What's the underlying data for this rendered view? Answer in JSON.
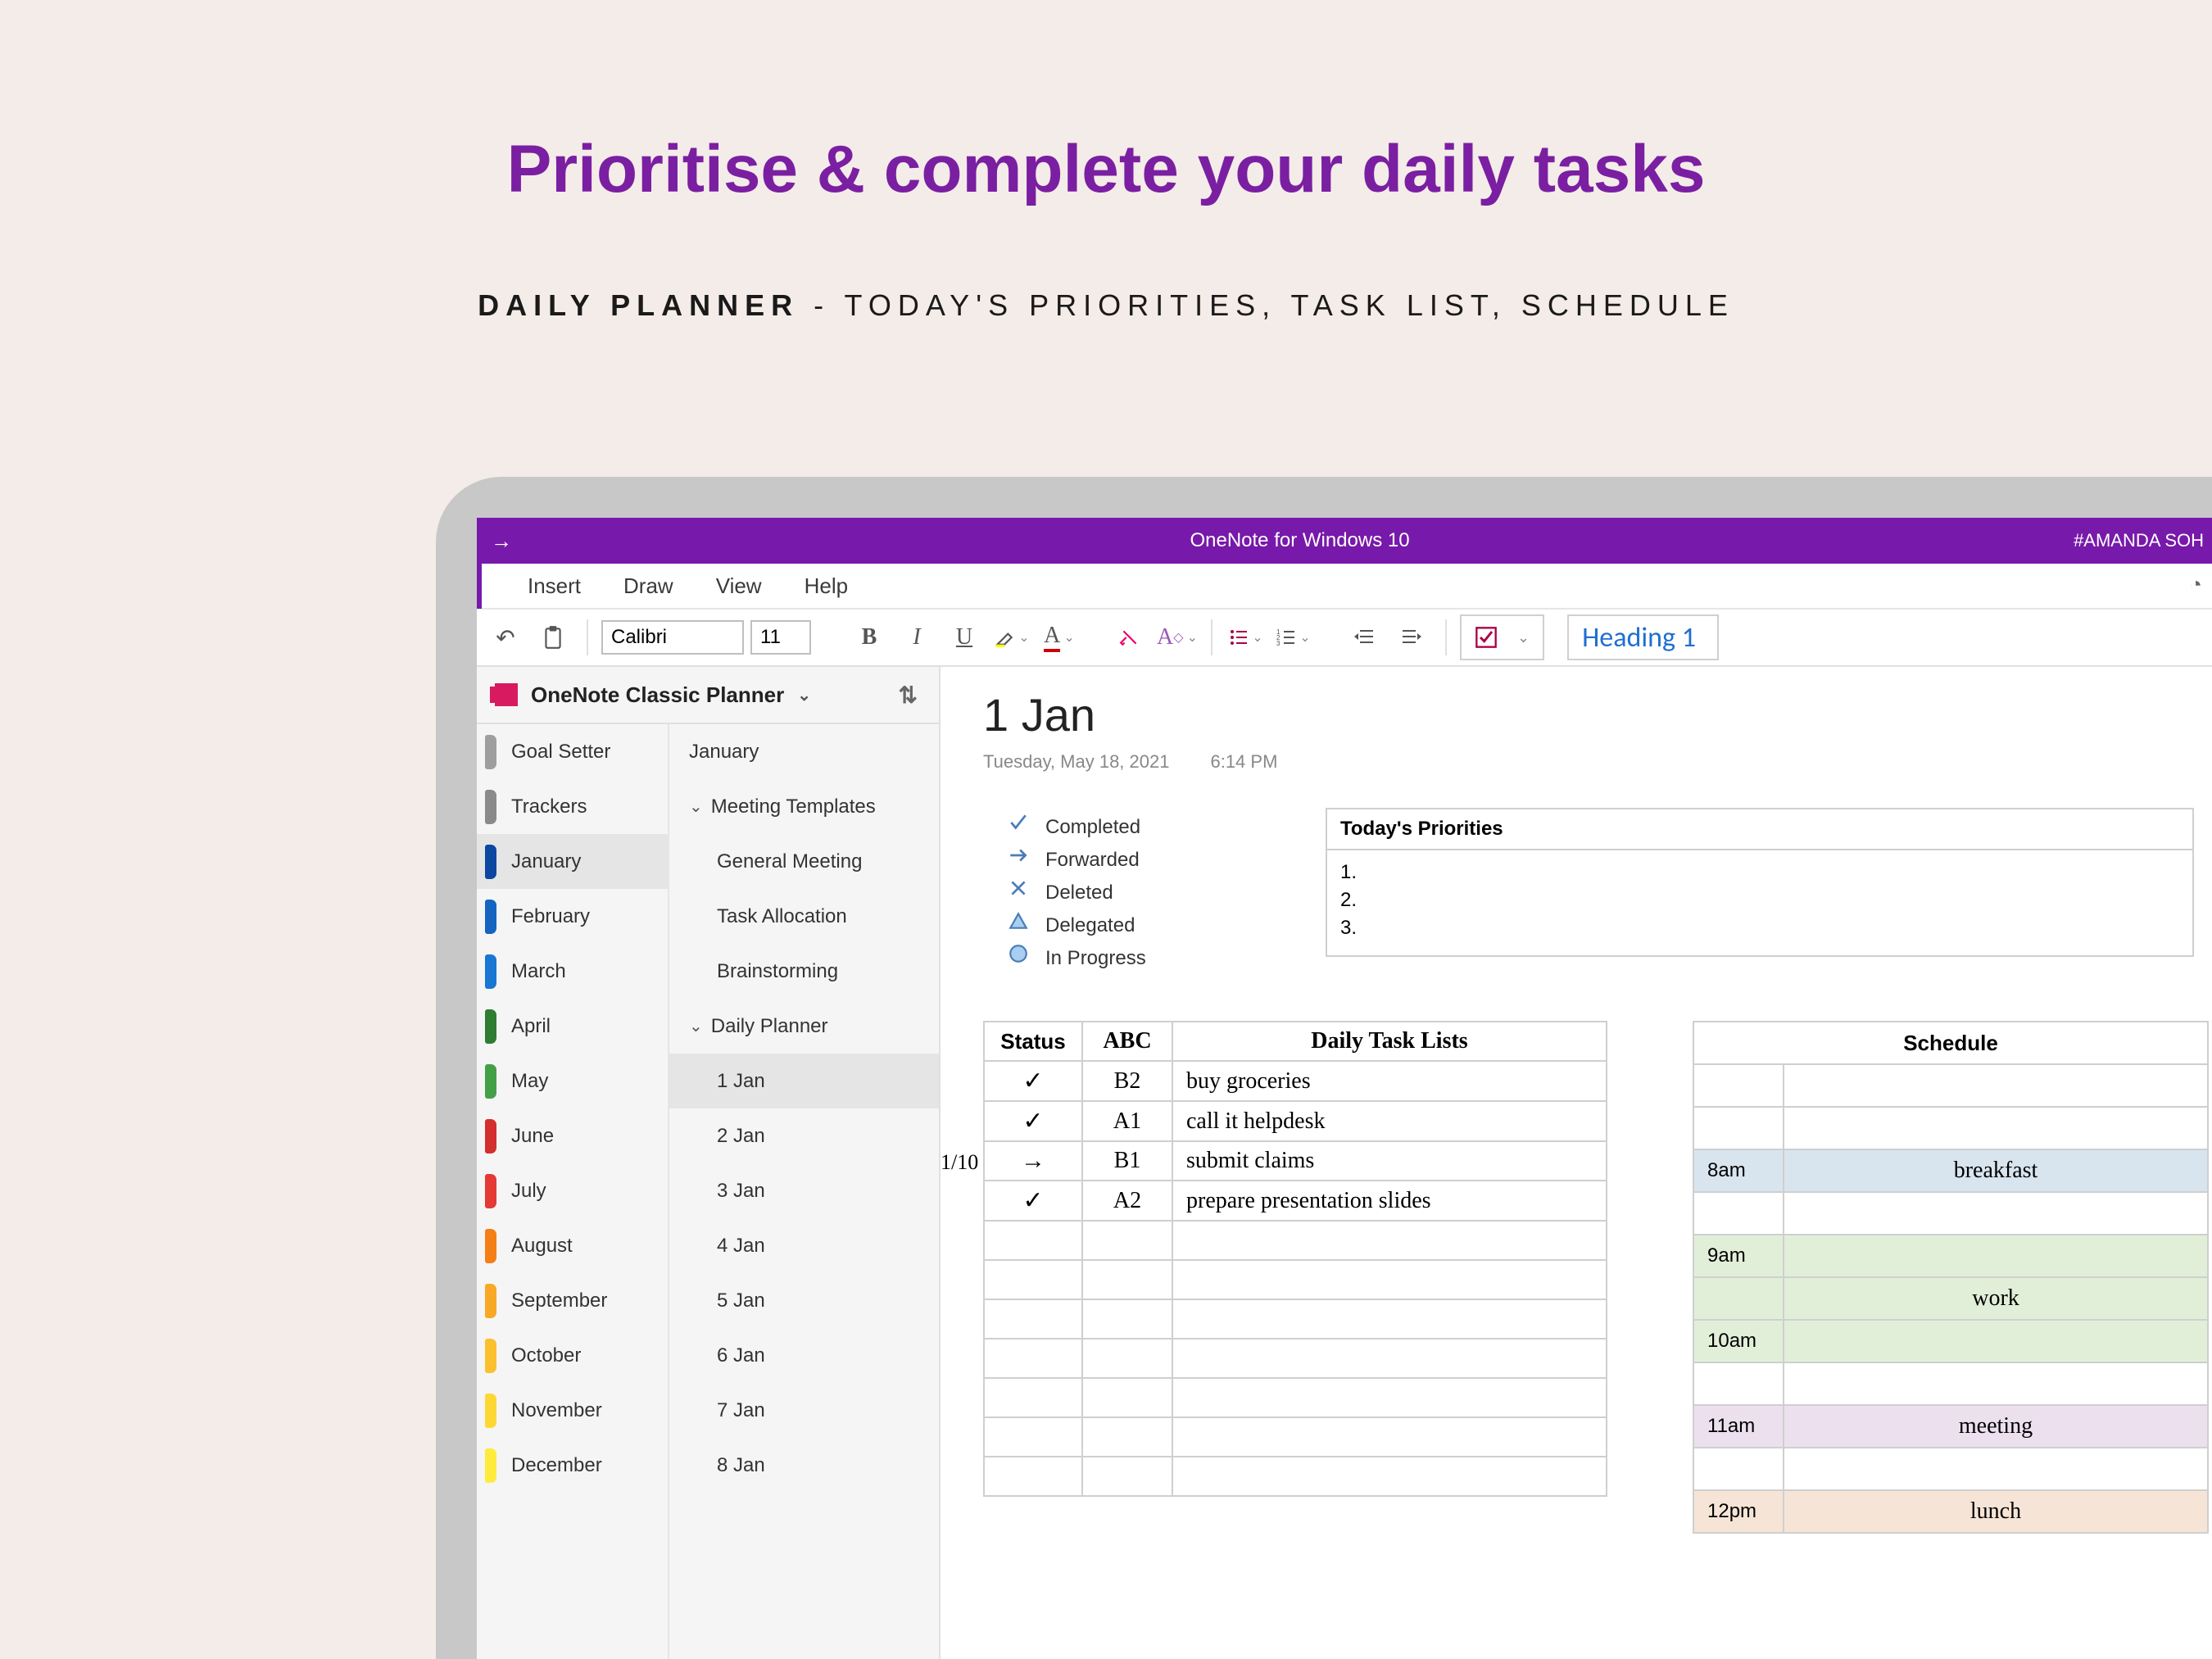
{
  "promo": {
    "headline": "Prioritise & complete your daily tasks",
    "sub_bold": "DAILY PLANNER",
    "sub_thin": " - TODAY'S PRIORITIES, TASK LIST, SCHEDULE"
  },
  "titlebar": {
    "app_title": "OneNote for Windows 10",
    "breadcrumb": "#AMANDA SOH"
  },
  "ribbon": {
    "items": [
      "Insert",
      "Draw",
      "View",
      "Help"
    ]
  },
  "toolbar": {
    "font_name": "Calibri",
    "font_size": "11",
    "heading_style": "Heading 1"
  },
  "notebook": {
    "name": "OneNote Classic Planner"
  },
  "sections": [
    {
      "label": "Goal Setter",
      "color": "#9e9e9e"
    },
    {
      "label": "Trackers",
      "color": "#8a8a8a"
    },
    {
      "label": "January",
      "color": "#0d47a1",
      "active": true
    },
    {
      "label": "February",
      "color": "#1565c0"
    },
    {
      "label": "March",
      "color": "#1976d2"
    },
    {
      "label": "April",
      "color": "#2e7d32"
    },
    {
      "label": "May",
      "color": "#43a047"
    },
    {
      "label": "June",
      "color": "#d32f2f"
    },
    {
      "label": "July",
      "color": "#e53935"
    },
    {
      "label": "August",
      "color": "#f57f17"
    },
    {
      "label": "September",
      "color": "#f9a825"
    },
    {
      "label": "October",
      "color": "#fbc02d"
    },
    {
      "label": "November",
      "color": "#fdd835"
    },
    {
      "label": "December",
      "color": "#ffeb3b"
    }
  ],
  "pages": [
    {
      "label": "January",
      "type": "top"
    },
    {
      "label": "Meeting Templates",
      "type": "group"
    },
    {
      "label": "General Meeting",
      "type": "sub"
    },
    {
      "label": "Task Allocation",
      "type": "sub"
    },
    {
      "label": "Brainstorming",
      "type": "sub"
    },
    {
      "label": "Daily Planner",
      "type": "group"
    },
    {
      "label": "1 Jan",
      "type": "sub",
      "active": true
    },
    {
      "label": "2 Jan",
      "type": "sub"
    },
    {
      "label": "3 Jan",
      "type": "sub"
    },
    {
      "label": "4 Jan",
      "type": "sub"
    },
    {
      "label": "5 Jan",
      "type": "sub"
    },
    {
      "label": "6 Jan",
      "type": "sub"
    },
    {
      "label": "7 Jan",
      "type": "sub"
    },
    {
      "label": "8 Jan",
      "type": "sub"
    }
  ],
  "page": {
    "title": "1 Jan",
    "date": "Tuesday, May 18, 2021",
    "time": "6:14 PM"
  },
  "legend": [
    {
      "icon": "check",
      "label": "Completed"
    },
    {
      "icon": "arrow",
      "label": "Forwarded"
    },
    {
      "icon": "x",
      "label": "Deleted"
    },
    {
      "icon": "triangle",
      "label": "Delegated"
    },
    {
      "icon": "circle",
      "label": "In Progress"
    }
  ],
  "priorities": {
    "header": "Today's Priorities",
    "lines": [
      "1.",
      "2.",
      "3."
    ]
  },
  "task_table": {
    "headers": [
      "Status",
      "ABC",
      "Daily Task Lists"
    ],
    "date_note": "1/10",
    "rows": [
      {
        "status": "check",
        "abc": "B2",
        "task": "buy groceries"
      },
      {
        "status": "check",
        "abc": "A1",
        "task": "call it helpdesk"
      },
      {
        "status": "arrow",
        "abc": "B1",
        "task": "submit claims"
      },
      {
        "status": "check",
        "abc": "A2",
        "task": "prepare presentation slides"
      }
    ],
    "blank_rows": 7
  },
  "schedule": {
    "header": "Schedule",
    "rows": [
      {
        "time": "",
        "label": "",
        "class": "plain"
      },
      {
        "time": "",
        "label": "",
        "class": "plain"
      },
      {
        "time": "8am",
        "label": "breakfast",
        "class": "blue"
      },
      {
        "time": "",
        "label": "",
        "class": "plain"
      },
      {
        "time": "9am",
        "label": "",
        "class": "green"
      },
      {
        "time": "",
        "label": "work",
        "class": "green"
      },
      {
        "time": "10am",
        "label": "",
        "class": "green"
      },
      {
        "time": "",
        "label": "",
        "class": "plain"
      },
      {
        "time": "11am",
        "label": "meeting",
        "class": "purple"
      },
      {
        "time": "",
        "label": "",
        "class": "plain"
      },
      {
        "time": "12pm",
        "label": "lunch",
        "class": "peach"
      }
    ]
  }
}
